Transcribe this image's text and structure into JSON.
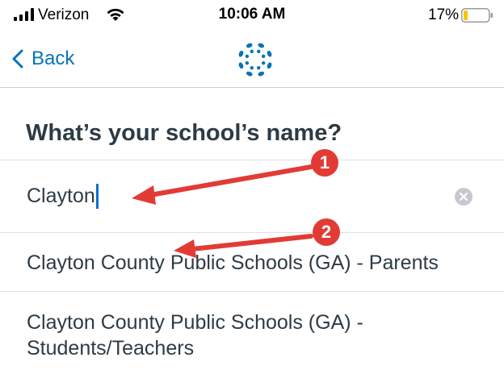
{
  "status_bar": {
    "carrier": "Verizon",
    "time": "10:06 AM",
    "battery_percent": "17%",
    "battery_level": 0.17
  },
  "nav": {
    "back_label": "Back",
    "logo_icon": "canvas-logo-icon",
    "accent_color": "#0374b5"
  },
  "page": {
    "heading": "What’s your school’s name?"
  },
  "search": {
    "value": "Clayton"
  },
  "results": [
    {
      "label": "Clayton County Public Schools (GA) - Parents"
    },
    {
      "label": "Clayton County Public Schools (GA) - Students/Teachers"
    }
  ],
  "annotations": {
    "badge_1": "1",
    "badge_2": "2",
    "color": "#e23b35"
  }
}
